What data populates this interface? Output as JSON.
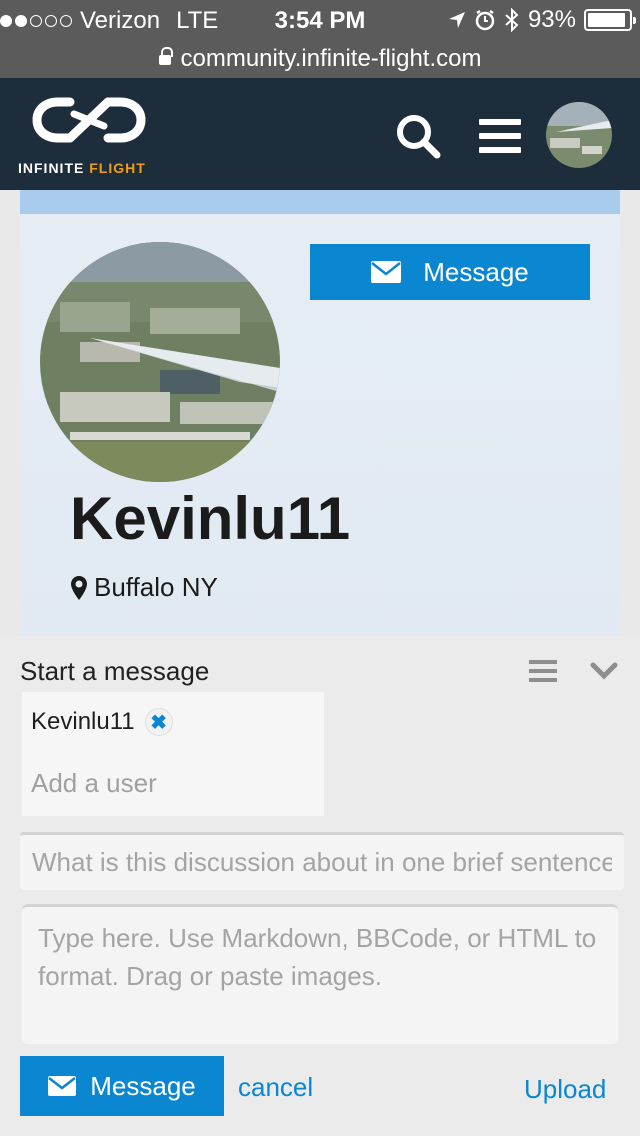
{
  "status_bar": {
    "carrier": "Verizon",
    "network": "LTE",
    "time": "3:54 PM",
    "battery": "93%",
    "battery_level": 0.93
  },
  "browser": {
    "url": "community.infinite-flight.com"
  },
  "site_header": {
    "logo_text_main": "INFINITE ",
    "logo_text_accent": "FLIGHT",
    "brand_color": "#1e2d3b",
    "accent_color": "#f29d13"
  },
  "profile": {
    "message_button_label": "Message",
    "username": "Kevinlu11",
    "location": "Buffalo NY"
  },
  "composer": {
    "title": "Start a message",
    "recipients": [
      "Kevinlu11"
    ],
    "add_user_placeholder": "Add a user",
    "title_placeholder": "What is this discussion about in one brief sentence?",
    "body_placeholder": "Type here. Use Markdown, BBCode, or HTML to format. Drag or paste images.",
    "send_label": "Message",
    "cancel_label": "cancel",
    "upload_label": "Upload",
    "primary_color": "#0a87d0"
  }
}
